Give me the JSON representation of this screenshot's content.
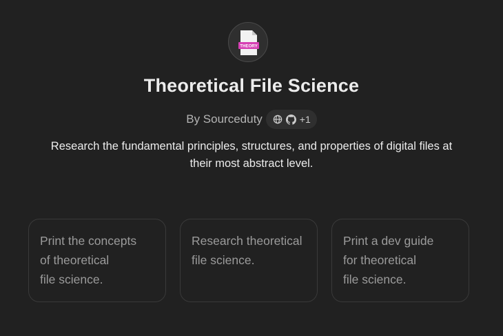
{
  "gpt": {
    "icon": "theory-file-icon",
    "icon_label": "THEORY",
    "title": "Theoretical File Science",
    "author": "By Sourceduty",
    "links": {
      "icons": [
        "globe-icon",
        "github-icon"
      ],
      "extra_count": "+1"
    },
    "description": "Research the fundamental principles, structures, and properties of digital files at their most abstract level."
  },
  "starters": [
    {
      "label": "Print the concepts\nof theoretical\nfile science."
    },
    {
      "label": "Research theoretical\nfile science."
    },
    {
      "label": "Print a dev guide\nfor theoretical\nfile science."
    }
  ],
  "colors": {
    "background": "#212121",
    "icon_accent": "#d63fb3"
  }
}
